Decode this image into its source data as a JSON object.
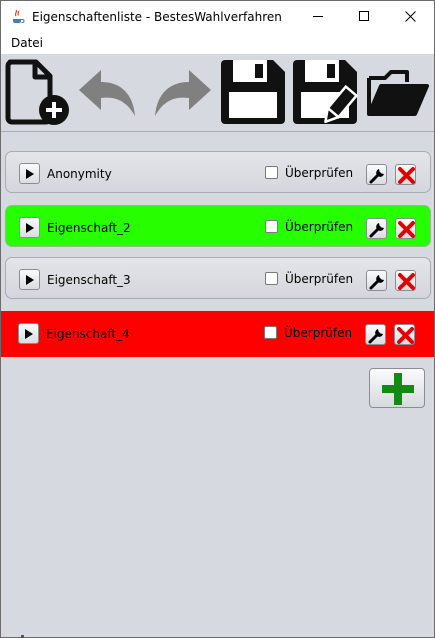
{
  "window": {
    "title": "Eigenschaftenliste - BestesWahlverfahren",
    "icons": [
      "java-app-icon",
      "minimize-icon",
      "maximize-icon",
      "close-icon"
    ]
  },
  "menubar": {
    "items": [
      {
        "label": "Datei"
      }
    ]
  },
  "toolbar": {
    "tools": [
      {
        "name": "new-file",
        "icon": "new-document-plus-icon"
      },
      {
        "name": "undo",
        "icon": "undo-arrow-icon"
      },
      {
        "name": "redo",
        "icon": "redo-arrow-icon"
      },
      {
        "name": "save",
        "icon": "floppy-disk-icon"
      },
      {
        "name": "save-as",
        "icon": "floppy-disk-pencil-icon"
      },
      {
        "name": "open",
        "icon": "open-folder-icon"
      }
    ]
  },
  "properties": [
    {
      "name": "Anonymity",
      "check_label": "Überprüfen",
      "checked": false,
      "color": "#d9dce1"
    },
    {
      "name": "Eigenschaft_2",
      "check_label": "Überprüfen",
      "checked": false,
      "color": "#27ff00"
    },
    {
      "name": "Eigenschaft_3",
      "check_label": "Überprüfen",
      "checked": false,
      "color": "#d9dce1"
    },
    {
      "name": "Eigenschaft_4",
      "check_label": "Überprüfen",
      "checked": false,
      "color": "#ff0000"
    }
  ],
  "row_icons": {
    "expand": "triangle-right-icon",
    "edit": "wrench-icon",
    "delete": "red-x-icon"
  },
  "add_button": {
    "icon": "green-plus-icon"
  }
}
